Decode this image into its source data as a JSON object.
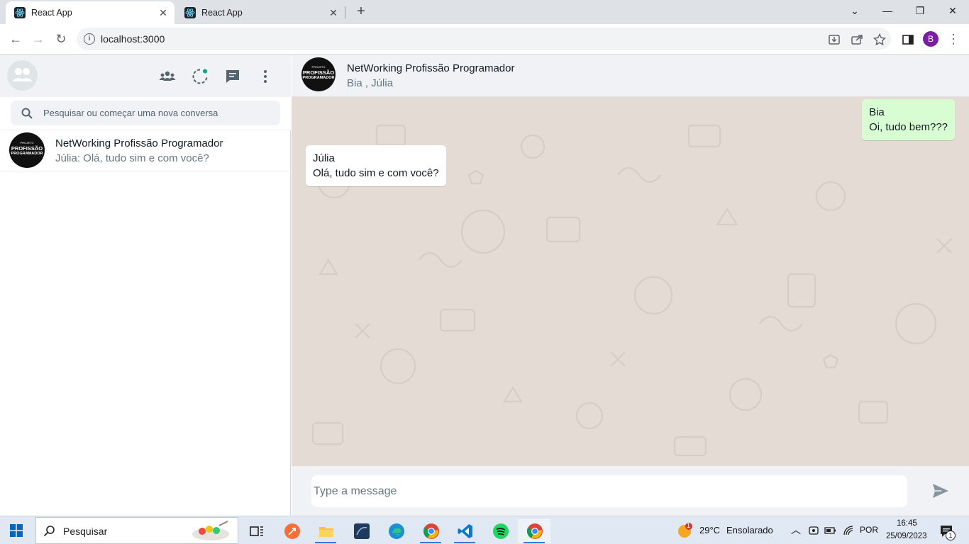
{
  "browser": {
    "tabs": [
      {
        "title": "React App",
        "active": true
      },
      {
        "title": "React App",
        "active": false
      }
    ],
    "url": "localhost:3000",
    "profile_initial": "B"
  },
  "sidebar": {
    "search_placeholder": "Pesquisar ou começar uma nova conversa",
    "chats": [
      {
        "name": "NetWorking Profissão Programador",
        "last_message": "Júlia: Olá, tudo sim e com você?"
      }
    ]
  },
  "avatar_logo": {
    "line1": "PROJETO",
    "line2": "PROFISSÃO",
    "line3": "PROGRAMADOR"
  },
  "conversation": {
    "title": "NetWorking Profissão Programador",
    "members": "Bia , Júlia",
    "messages": [
      {
        "author": "Bia",
        "text": "Oi, tudo bem???",
        "direction": "outgoing"
      },
      {
        "author": "Júlia",
        "text": "Olá, tudo sim e com você?",
        "direction": "incoming"
      }
    ],
    "input_placeholder": "Type a message"
  },
  "taskbar": {
    "search_label": "Pesquisar",
    "weather_temp": "29°C",
    "weather_desc": "Ensolarado",
    "weather_badge": "1",
    "language": "POR",
    "time": "16:45",
    "date": "25/09/2023",
    "notification_count": "1"
  },
  "colors": {
    "header_bg": "#f0f2f5",
    "chat_bg": "#e4dcd4",
    "outgoing_bubble": "#d9fdd3",
    "incoming_bubble": "#ffffff",
    "taskbar_bg": "#dfe8f3"
  }
}
